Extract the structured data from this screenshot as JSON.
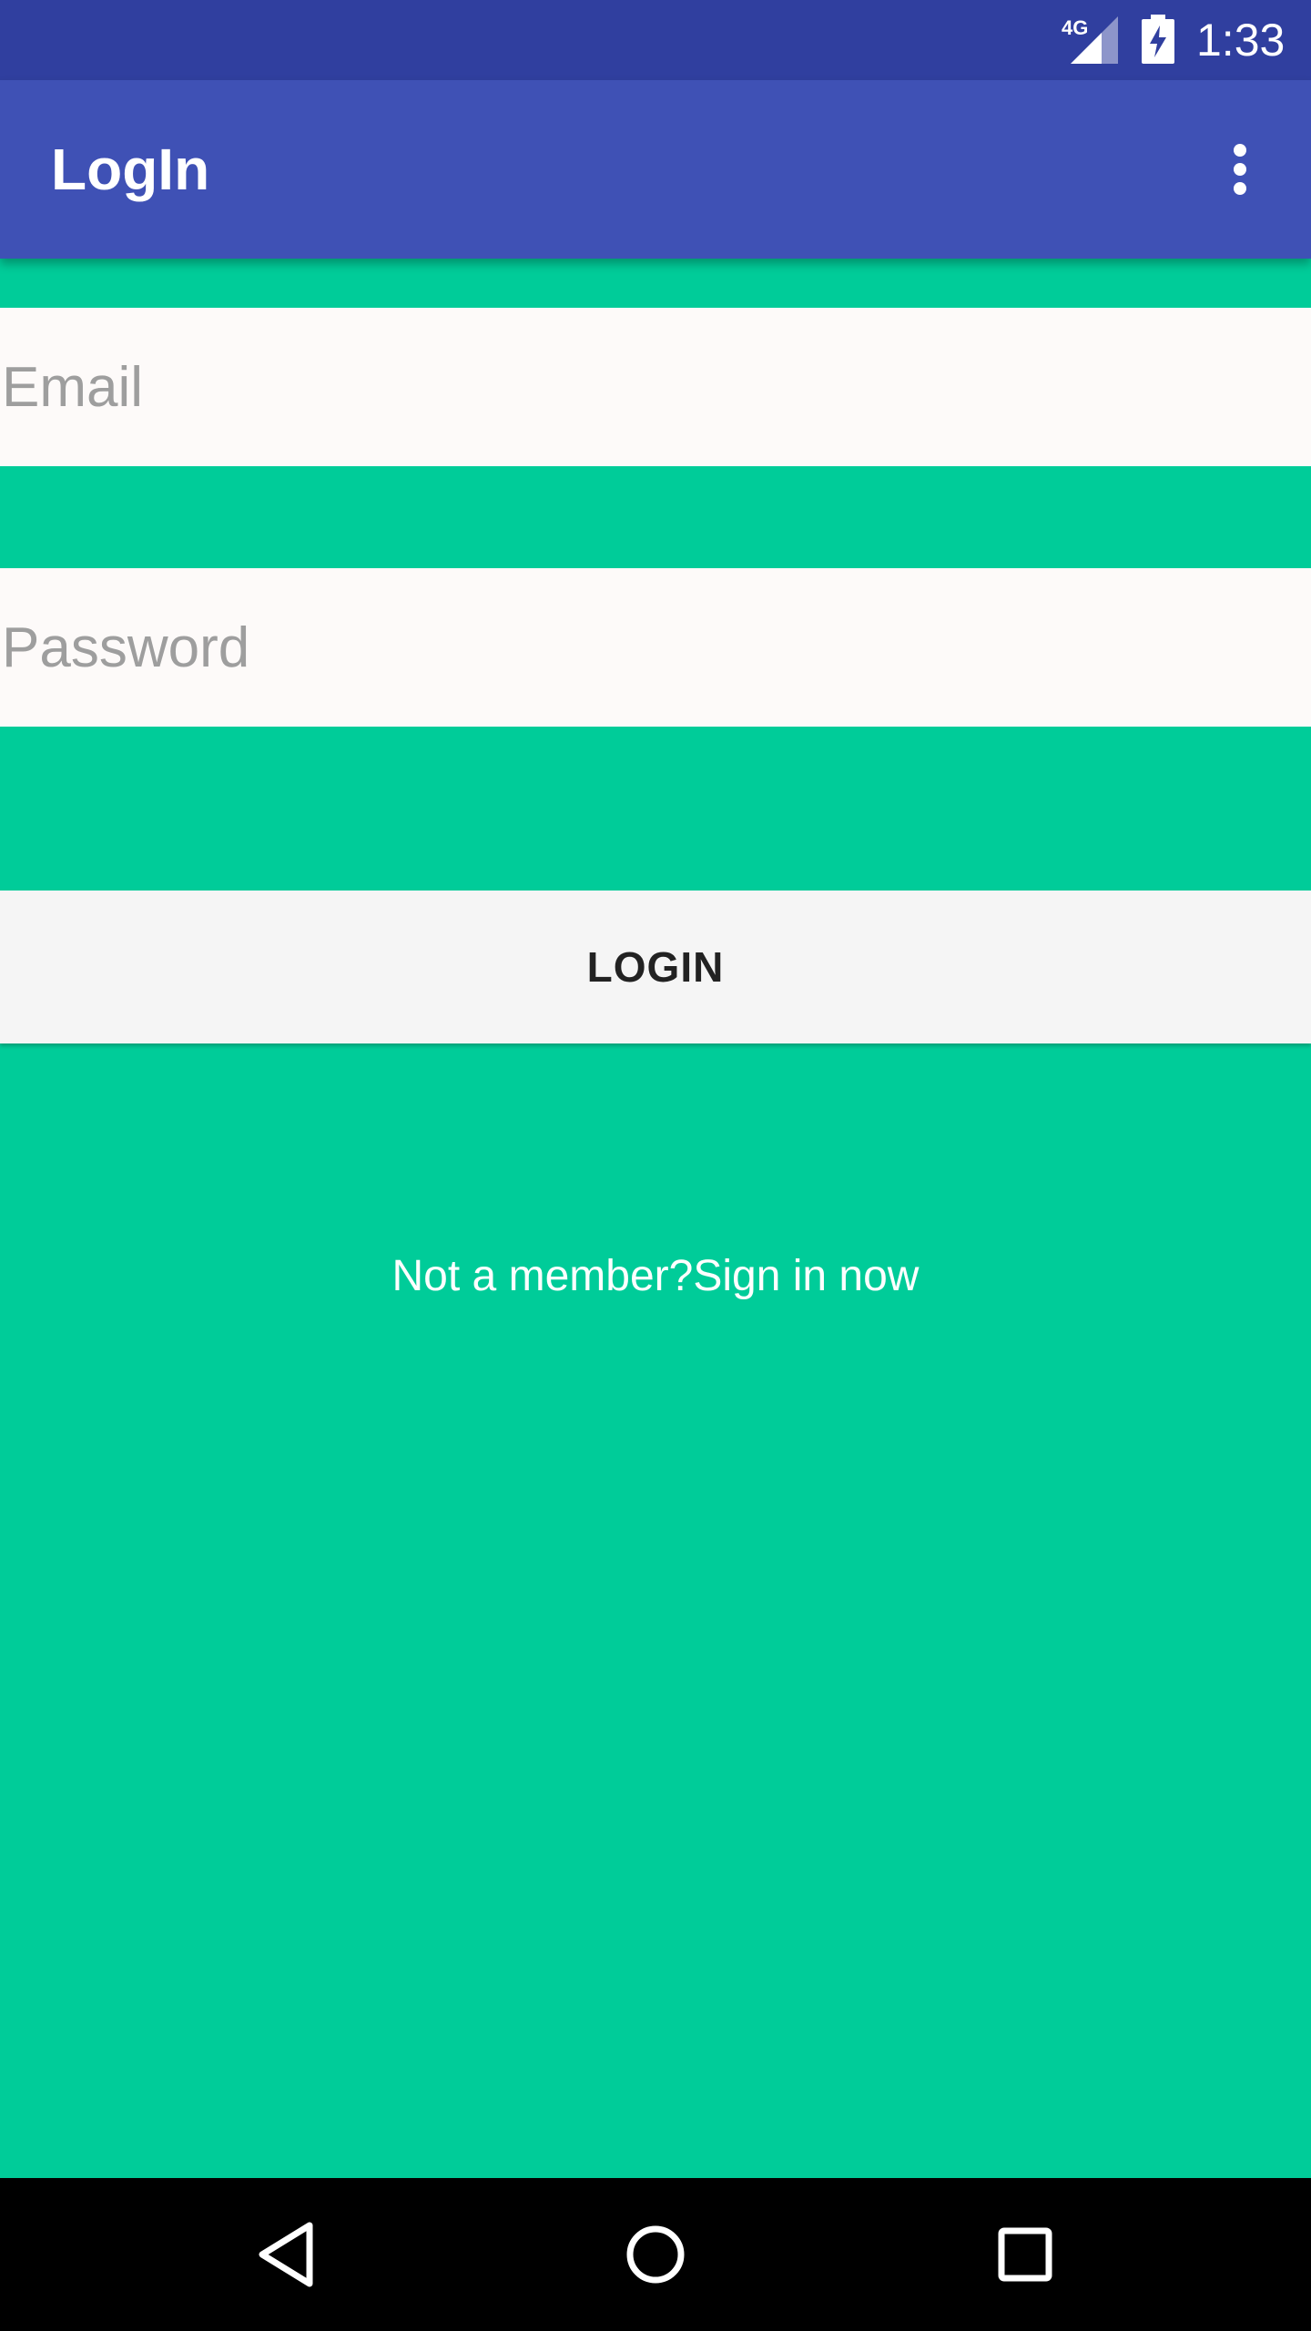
{
  "status_bar": {
    "network": "4G",
    "time": "1:33"
  },
  "app_bar": {
    "title": "LogIn",
    "overflow_icon": "more-vert-icon"
  },
  "form": {
    "email_placeholder": "Email",
    "password_placeholder": "Password",
    "login_label": "LOGIN",
    "signup_text": "Not a member?Sign in now"
  },
  "nav_bar": {
    "back_icon": "back-icon",
    "home_icon": "home-icon",
    "recents_icon": "recents-icon"
  },
  "colors": {
    "status_bar": "#303F9F",
    "app_bar": "#3F51B5",
    "background": "#00CC99",
    "input_background": "#FDFAF9",
    "button_background": "#F5F5F5"
  }
}
